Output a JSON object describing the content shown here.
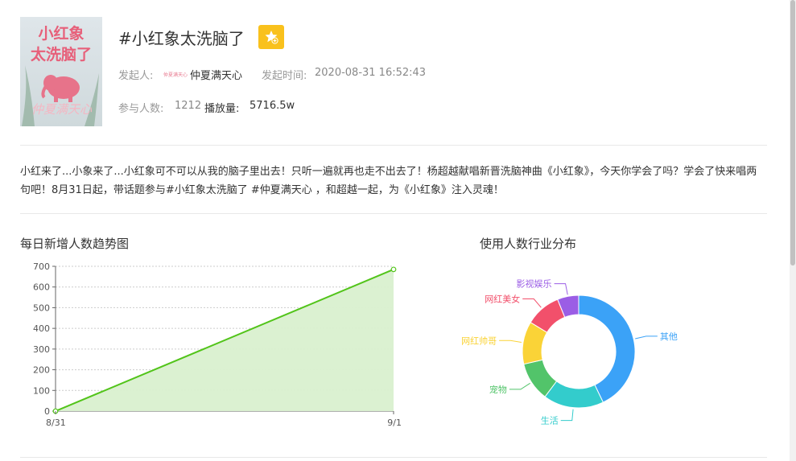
{
  "cover": {
    "line1": "小红象",
    "line2": "太洗脑了",
    "signature": "仲夏满天心"
  },
  "topic": {
    "title": "#小红象太洗脑了",
    "favorite_icon": "star-plus-icon",
    "initiator_label": "发起人:",
    "initiator_logo": "仲夏满天心",
    "initiator_name": "仲夏满天心",
    "time_label": "发起时间:",
    "time_value": "2020-08-31 16:52:43",
    "participants_label": "参与人数:",
    "participants_value": "1212",
    "plays_label": "播放量:",
    "plays_value": "5716.5w"
  },
  "description": "小红来了...小象来了...小红象可不可以从我的脑子里出去！只听一遍就再也走不出去了！杨超越献唱新晋洗脑神曲《小红象》，今天你学会了吗？学会了快来唱两句吧！8月31日起，带话题参与#小红象太洗脑了 #仲夏满天心 ，和超越一起，为《小红象》注入灵魂！",
  "line_chart_title": "每日新增人数趋势图",
  "pie_chart_title": "使用人数行业分布",
  "colors": {
    "accent": "#f9c11c",
    "line": "#52c41a",
    "area": "#d9f0cf"
  },
  "chart_data": [
    {
      "type": "area",
      "x": [
        "8/31",
        "9/1"
      ],
      "values": [
        0,
        685
      ],
      "yticks": [
        0,
        100,
        200,
        300,
        400,
        500,
        600,
        700
      ],
      "ylim": [
        0,
        700
      ],
      "grid": true,
      "title": "每日新增人数趋势图"
    },
    {
      "type": "pie",
      "title": "使用人数行业分布",
      "labels": [
        "其他",
        "生活",
        "宠物",
        "网红帅哥",
        "网红美女",
        "影视娱乐"
      ],
      "values": [
        42,
        17,
        11,
        12,
        10,
        6
      ],
      "colors": [
        "#3ba2f7",
        "#33cccc",
        "#52c46a",
        "#fad337",
        "#f2506b",
        "#9b5de5"
      ]
    }
  ]
}
